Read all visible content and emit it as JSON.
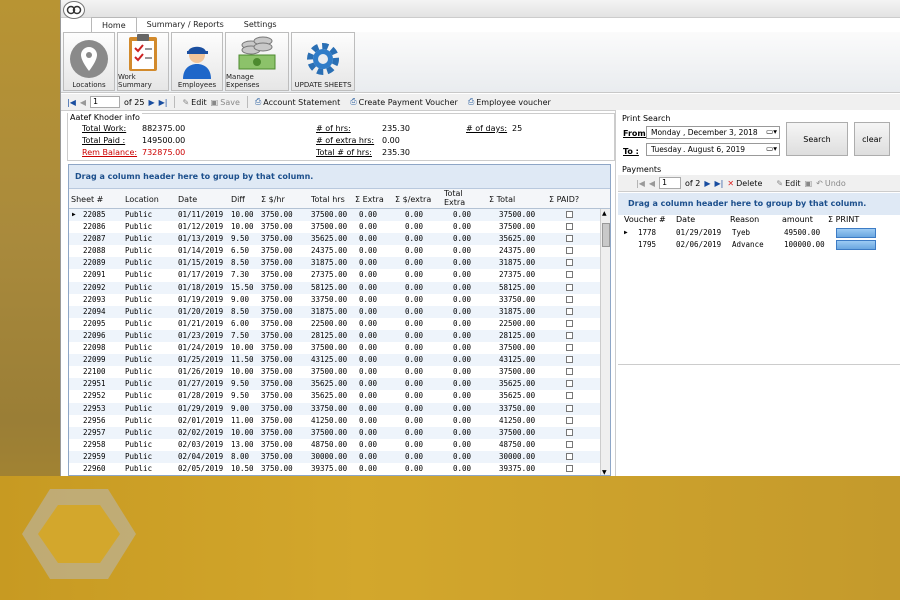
{
  "tabs": [
    "Home",
    "Summary / Reports",
    "Settings"
  ],
  "ribbon": [
    "Locations",
    "Work Summary",
    "Employees",
    "Manage Expenses",
    "UPDATE SHEETS"
  ],
  "nav": {
    "page": "1",
    "of": "of 25",
    "edit": "Edit",
    "save": "Save",
    "account": "Account Statement",
    "payment": "Create Payment Voucher",
    "voucher": "Employee voucher"
  },
  "info": {
    "title": "Aatef Khoder info",
    "total_work_label": "Total Work:",
    "total_work": "882375.00",
    "total_paid_label": "Total Paid :",
    "total_paid": "149500.00",
    "rem_label": "Rem Balance:",
    "rem": "732875.00",
    "hrs_label": "# of hrs:",
    "hrs": "235.30",
    "extra_label": "# of extra hrs:",
    "extra": "0.00",
    "total_hrs_label": "Total # of hrs:",
    "total_hrs": "235.30",
    "days_label": "# of days:",
    "days": "25"
  },
  "grid": {
    "group_hint": "Drag a column header here to group by that column.",
    "headers": [
      "Sheet #",
      "Location",
      "Date",
      "Diff",
      "Σ $/hr",
      "Total hrs",
      "Σ Extra",
      "Σ $/extra",
      "Total Extra",
      "Σ Total",
      "Σ PAID?"
    ],
    "rows": [
      [
        "22085",
        "Public",
        "01/11/2019",
        "10.00",
        "3750.00",
        "37500.00",
        "0.00",
        "0.00",
        "0.00",
        "37500.00"
      ],
      [
        "22086",
        "Public",
        "01/12/2019",
        "10.00",
        "3750.00",
        "37500.00",
        "0.00",
        "0.00",
        "0.00",
        "37500.00"
      ],
      [
        "22087",
        "Public",
        "01/13/2019",
        "9.50",
        "3750.00",
        "35625.00",
        "0.00",
        "0.00",
        "0.00",
        "35625.00"
      ],
      [
        "22088",
        "Public",
        "01/14/2019",
        "6.50",
        "3750.00",
        "24375.00",
        "0.00",
        "0.00",
        "0.00",
        "24375.00"
      ],
      [
        "22089",
        "Public",
        "01/15/2019",
        "8.50",
        "3750.00",
        "31875.00",
        "0.00",
        "0.00",
        "0.00",
        "31875.00"
      ],
      [
        "22091",
        "Public",
        "01/17/2019",
        "7.30",
        "3750.00",
        "27375.00",
        "0.00",
        "0.00",
        "0.00",
        "27375.00"
      ],
      [
        "22092",
        "Public",
        "01/18/2019",
        "15.50",
        "3750.00",
        "58125.00",
        "0.00",
        "0.00",
        "0.00",
        "58125.00"
      ],
      [
        "22093",
        "Public",
        "01/19/2019",
        "9.00",
        "3750.00",
        "33750.00",
        "0.00",
        "0.00",
        "0.00",
        "33750.00"
      ],
      [
        "22094",
        "Public",
        "01/20/2019",
        "8.50",
        "3750.00",
        "31875.00",
        "0.00",
        "0.00",
        "0.00",
        "31875.00"
      ],
      [
        "22095",
        "Public",
        "01/21/2019",
        "6.00",
        "3750.00",
        "22500.00",
        "0.00",
        "0.00",
        "0.00",
        "22500.00"
      ],
      [
        "22096",
        "Public",
        "01/23/2019",
        "7.50",
        "3750.00",
        "28125.00",
        "0.00",
        "0.00",
        "0.00",
        "28125.00"
      ],
      [
        "22098",
        "Public",
        "01/24/2019",
        "10.00",
        "3750.00",
        "37500.00",
        "0.00",
        "0.00",
        "0.00",
        "37500.00"
      ],
      [
        "22099",
        "Public",
        "01/25/2019",
        "11.50",
        "3750.00",
        "43125.00",
        "0.00",
        "0.00",
        "0.00",
        "43125.00"
      ],
      [
        "22100",
        "Public",
        "01/26/2019",
        "10.00",
        "3750.00",
        "37500.00",
        "0.00",
        "0.00",
        "0.00",
        "37500.00"
      ],
      [
        "22951",
        "Public",
        "01/27/2019",
        "9.50",
        "3750.00",
        "35625.00",
        "0.00",
        "0.00",
        "0.00",
        "35625.00"
      ],
      [
        "22952",
        "Public",
        "01/28/2019",
        "9.50",
        "3750.00",
        "35625.00",
        "0.00",
        "0.00",
        "0.00",
        "35625.00"
      ],
      [
        "22953",
        "Public",
        "01/29/2019",
        "9.00",
        "3750.00",
        "33750.00",
        "0.00",
        "0.00",
        "0.00",
        "33750.00"
      ],
      [
        "22956",
        "Public",
        "02/01/2019",
        "11.00",
        "3750.00",
        "41250.00",
        "0.00",
        "0.00",
        "0.00",
        "41250.00"
      ],
      [
        "22957",
        "Public",
        "02/02/2019",
        "10.00",
        "3750.00",
        "37500.00",
        "0.00",
        "0.00",
        "0.00",
        "37500.00"
      ],
      [
        "22958",
        "Public",
        "02/03/2019",
        "13.00",
        "3750.00",
        "48750.00",
        "0.00",
        "0.00",
        "0.00",
        "48750.00"
      ],
      [
        "22959",
        "Public",
        "02/04/2019",
        "8.00",
        "3750.00",
        "30000.00",
        "0.00",
        "0.00",
        "0.00",
        "30000.00"
      ],
      [
        "22960",
        "Public",
        "02/05/2019",
        "10.50",
        "3750.00",
        "39375.00",
        "0.00",
        "0.00",
        "0.00",
        "39375.00"
      ]
    ]
  },
  "print": {
    "title": "Print Search",
    "from_label": "From:",
    "from_day": "Monday",
    "from_date": ", December  3, 2018",
    "to_label": "To :",
    "to_day": "Tuesday",
    "to_date": ".  August    6, 2019",
    "search": "Search",
    "clear": "clear"
  },
  "payments": {
    "title": "Payments",
    "page": "1",
    "of": "of 2",
    "delete": "Delete",
    "edit": "Edit",
    "undo": "Undo",
    "group_hint": "Drag a column header here to group by that column.",
    "headers": [
      "Voucher #",
      "Date",
      "Reason",
      "amount",
      "Σ PRINT"
    ],
    "rows": [
      [
        "1778",
        "01/29/2019",
        "Tyeb",
        "49500.00"
      ],
      [
        "1795",
        "02/06/2019",
        "Advance",
        "100000.00"
      ]
    ]
  }
}
